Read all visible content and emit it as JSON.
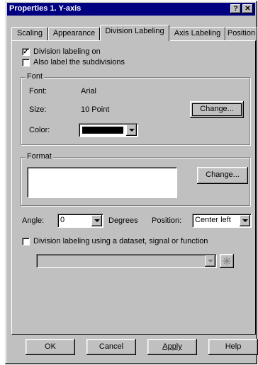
{
  "window": {
    "title": "Properties 1. Y-axis",
    "help_button": "?",
    "close_button": "✕"
  },
  "tabs": [
    {
      "label": "Scaling"
    },
    {
      "label": "Appearance"
    },
    {
      "label": "Division Labeling",
      "active": true
    },
    {
      "label": "Axis Labeling"
    },
    {
      "label": "Position"
    }
  ],
  "options": {
    "division_labeling_on": {
      "label": "Division labeling on",
      "checked": true
    },
    "label_subdivisions": {
      "label": "Also label the subdivisions",
      "checked": false
    }
  },
  "font_group": {
    "legend": "Font",
    "font_label": "Font:",
    "font_value": "Arial",
    "size_label": "Size:",
    "size_value": "10 Point",
    "color_label": "Color:",
    "color_value": "#000000",
    "change_button": "Change..."
  },
  "format_group": {
    "legend": "Format",
    "text": "",
    "change_button": "Change..."
  },
  "angle": {
    "label": "Angle:",
    "value": "0",
    "unit": "Degrees"
  },
  "position": {
    "label": "Position:",
    "value": "Center left"
  },
  "dataset_option": {
    "label": "Division labeling using a dataset, signal or function",
    "checked": false,
    "select_value": ""
  },
  "footer": {
    "ok": "OK",
    "cancel": "Cancel",
    "apply": "Apply",
    "help": "Help"
  }
}
